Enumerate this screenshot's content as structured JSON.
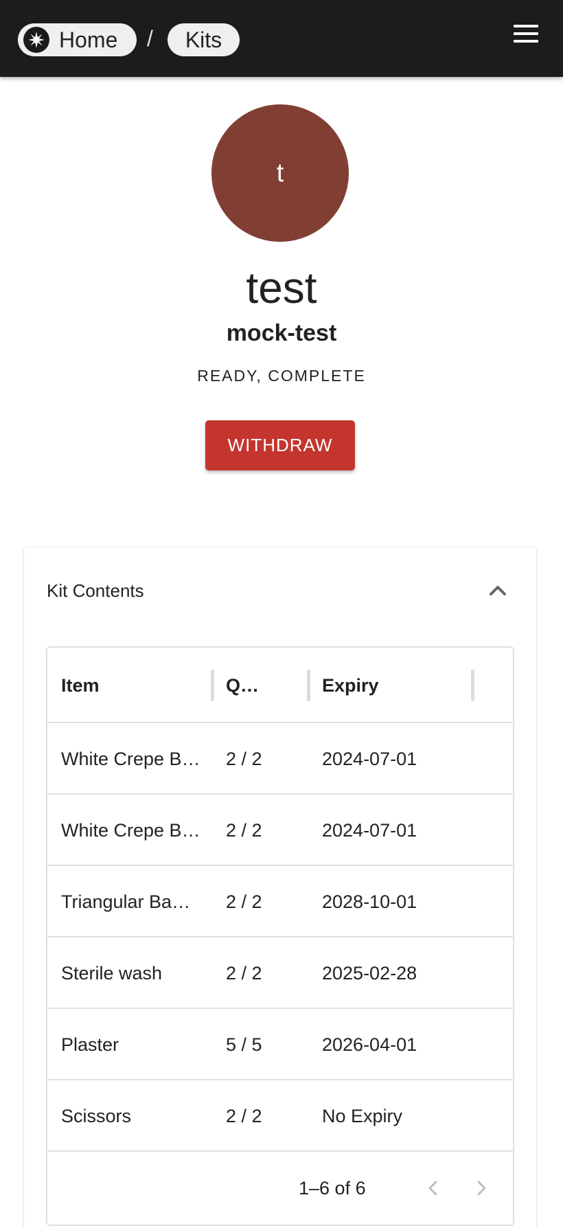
{
  "breadcrumb": {
    "home_label": "Home",
    "separator": "/",
    "kits_label": "Kits"
  },
  "kit": {
    "avatar_letter": "t",
    "name": "test",
    "code": "mock-test",
    "status": "READY, COMPLETE",
    "withdraw_label": "WITHDRAW"
  },
  "contents": {
    "title": "Kit Contents",
    "columns": [
      "Item",
      "Q…",
      "Expiry"
    ],
    "rows": [
      {
        "item": "White Crepe B…",
        "qty": "2 / 2",
        "expiry": "2024-07-01"
      },
      {
        "item": "White Crepe B…",
        "qty": "2 / 2",
        "expiry": "2024-07-01"
      },
      {
        "item": "Triangular Ba…",
        "qty": "2 / 2",
        "expiry": "2028-10-01"
      },
      {
        "item": "Sterile wash",
        "qty": "2 / 2",
        "expiry": "2025-02-28"
      },
      {
        "item": "Plaster",
        "qty": "5 / 5",
        "expiry": "2026-04-01"
      },
      {
        "item": "Scissors",
        "qty": "2 / 2",
        "expiry": "No Expiry"
      }
    ],
    "pagination": "1–6 of 6"
  },
  "colors": {
    "appbar": "#1c1c1c",
    "avatar": "#813f34",
    "withdraw_button": "#c4352e"
  },
  "icons": [
    "logo-icon",
    "menu-icon",
    "chevron-up-icon",
    "chevron-left-icon",
    "chevron-right-icon"
  ]
}
